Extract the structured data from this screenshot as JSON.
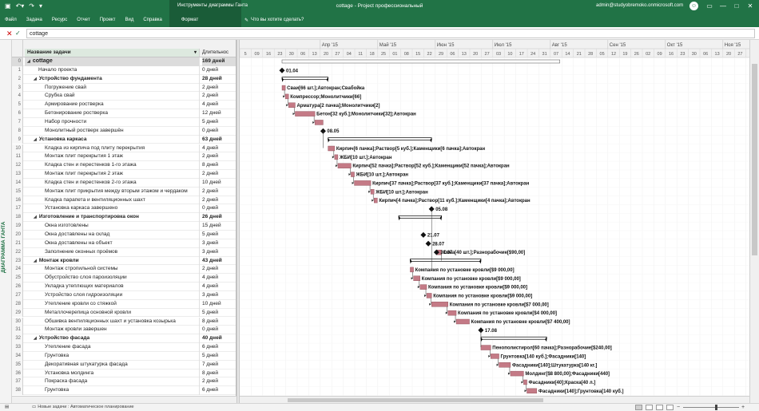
{
  "window": {
    "title": "cottage  -  Project профессиональный",
    "account": "admin@studyobremoko.onmicrosoft.com",
    "avatar": "☺",
    "context_tab_group": "Инструменты диаграммы Ганта",
    "context_tab": "Формат",
    "tell_me": "Что вы хотите сделать?",
    "help_icon": "question-icon"
  },
  "ribbon": {
    "tabs": [
      "Файл",
      "Задача",
      "Ресурс",
      "Отчет",
      "Проект",
      "Вид",
      "Справка"
    ]
  },
  "entry_bar": {
    "value": "cottage"
  },
  "side_view_label": "ДИАГРАММА ГАНТА",
  "grid": {
    "col_name": "Название задачи",
    "col_duration": "Длительнос",
    "rows": [
      {
        "id": "0",
        "name": "cottage",
        "dur": "169 дней",
        "level": 0,
        "summary": true
      },
      {
        "id": "1",
        "name": "Начало проекта",
        "dur": "0 дней",
        "level": 1,
        "summary": false
      },
      {
        "id": "2",
        "name": "Устройство фундамента",
        "dur": "28 дней",
        "level": 1,
        "summary": true
      },
      {
        "id": "3",
        "name": "Погружение свай",
        "dur": "2 дней",
        "level": 2,
        "summary": false
      },
      {
        "id": "4",
        "name": "Срубка свай",
        "dur": "2 дней",
        "level": 2,
        "summary": false
      },
      {
        "id": "5",
        "name": "Армирование ростверка",
        "dur": "4 дней",
        "level": 2,
        "summary": false
      },
      {
        "id": "6",
        "name": "Бетонирование ростверка",
        "dur": "12 дней",
        "level": 2,
        "summary": false
      },
      {
        "id": "7",
        "name": "Набор прочности",
        "dur": "5 дней",
        "level": 2,
        "summary": false
      },
      {
        "id": "8",
        "name": "Монолитный ростверк завершён",
        "dur": "0 дней",
        "level": 2,
        "summary": false
      },
      {
        "id": "9",
        "name": "Установка каркаса",
        "dur": "63 дней",
        "level": 1,
        "summary": true
      },
      {
        "id": "10",
        "name": "Кладка из кирпича под плиту перекрытия",
        "dur": "4 дней",
        "level": 2,
        "summary": false
      },
      {
        "id": "11",
        "name": "Монтаж плит перекрытия 1 этаж",
        "dur": "2 дней",
        "level": 2,
        "summary": false
      },
      {
        "id": "12",
        "name": "Кладка стен и перестенков 1-го этажа",
        "dur": "8 дней",
        "level": 2,
        "summary": false
      },
      {
        "id": "13",
        "name": "Монтаж плит перекрытия 2 этаж",
        "dur": "2 дней",
        "level": 2,
        "summary": false
      },
      {
        "id": "14",
        "name": "Кладка стен и перестенков 2-го этажа",
        "dur": "10 дней",
        "level": 2,
        "summary": false
      },
      {
        "id": "15",
        "name": "Монтаж плит прикрытия между вторым этажом и чердаком",
        "dur": "2 дней",
        "level": 2,
        "summary": false
      },
      {
        "id": "16",
        "name": "Кладка парапета и вентиляционных шахт",
        "dur": "2 дней",
        "level": 2,
        "summary": false
      },
      {
        "id": "17",
        "name": "Установка каркаса завершено",
        "dur": "0 дней",
        "level": 2,
        "summary": false
      },
      {
        "id": "18",
        "name": "Изготовление и транспортировка окон",
        "dur": "26 дней",
        "level": 1,
        "summary": true
      },
      {
        "id": "19",
        "name": "Окна изготовлены",
        "dur": "15 дней",
        "level": 2,
        "summary": false
      },
      {
        "id": "20",
        "name": "Окна доставлены на склад",
        "dur": "5 дней",
        "level": 2,
        "summary": false
      },
      {
        "id": "21",
        "name": "Окна доставлены на объект",
        "dur": "3 дней",
        "level": 2,
        "summary": false
      },
      {
        "id": "22",
        "name": "Заполнение оконных проёмов",
        "dur": "3 дней",
        "level": 2,
        "summary": false
      },
      {
        "id": "23",
        "name": "Монтаж кровли",
        "dur": "43 дней",
        "level": 1,
        "summary": true
      },
      {
        "id": "24",
        "name": "Монтаж стропильной системы",
        "dur": "2 дней",
        "level": 2,
        "summary": false
      },
      {
        "id": "25",
        "name": "Обустройство слоя пароизоляции",
        "dur": "4 дней",
        "level": 2,
        "summary": false
      },
      {
        "id": "26",
        "name": "Укладка утеплющих материалов",
        "dur": "4 дней",
        "level": 2,
        "summary": false
      },
      {
        "id": "27",
        "name": "Устройство слоя гидроизоляции",
        "dur": "3 дней",
        "level": 2,
        "summary": false
      },
      {
        "id": "28",
        "name": "Утепление кровли со стяжкой",
        "dur": "10 дней",
        "level": 2,
        "summary": false
      },
      {
        "id": "29",
        "name": "Металлочерепица основной кровли",
        "dur": "5 дней",
        "level": 2,
        "summary": false
      },
      {
        "id": "30",
        "name": "Обшивка вентиляционных шахт и установка козырька",
        "dur": "8 дней",
        "level": 2,
        "summary": false
      },
      {
        "id": "31",
        "name": "Монтаж кровли завершен",
        "dur": "0 дней",
        "level": 2,
        "summary": false
      },
      {
        "id": "32",
        "name": "Устройство фасада",
        "dur": "40 дней",
        "level": 1,
        "summary": true
      },
      {
        "id": "33",
        "name": "Утепление фасада",
        "dur": "6 дней",
        "level": 2,
        "summary": false
      },
      {
        "id": "34",
        "name": "Грунтовка",
        "dur": "5 дней",
        "level": 2,
        "summary": false
      },
      {
        "id": "35",
        "name": "Декоративная штукатурка фасада",
        "dur": "7 дней",
        "level": 2,
        "summary": false
      },
      {
        "id": "36",
        "name": "Установка молдинга",
        "dur": "8 дней",
        "level": 2,
        "summary": false
      },
      {
        "id": "37",
        "name": "Покраска фасада",
        "dur": "2 дней",
        "level": 2,
        "summary": false
      },
      {
        "id": "38",
        "name": "Грунтовка",
        "dur": "6 дней",
        "level": 2,
        "summary": false
      }
    ]
  },
  "timescale": {
    "months": [
      {
        "label": "Апр '15",
        "col": 7
      },
      {
        "label": "Май '15",
        "col": 12
      },
      {
        "label": "Июн '15",
        "col": 17
      },
      {
        "label": "Июл '15",
        "col": 22
      },
      {
        "label": "Авг '15",
        "col": 27
      },
      {
        "label": "Сен '15",
        "col": 32
      },
      {
        "label": "Окт '15",
        "col": 37
      },
      {
        "label": "Ноя '15",
        "col": 42
      },
      {
        "label": "Дек '15",
        "col": 47
      }
    ],
    "weeks": [
      "5",
      "09",
      "16",
      "23",
      "30",
      "06",
      "13",
      "20",
      "27",
      "04",
      "11",
      "18",
      "25",
      "01",
      "08",
      "15",
      "22",
      "29",
      "06",
      "13",
      "20",
      "27",
      "03",
      "10",
      "17",
      "24",
      "31",
      "07",
      "14",
      "21",
      "28",
      "05",
      "12",
      "19",
      "26",
      "02",
      "09",
      "16",
      "23",
      "30",
      "06",
      "13",
      "20",
      "27",
      "04",
      "11",
      "18",
      "25"
    ]
  },
  "gantt": {
    "summaries": [
      {
        "row": 0,
        "start": 0,
        "end": 169
      },
      {
        "row": 2,
        "start": 0,
        "end": 28
      },
      {
        "row": 9,
        "start": 28,
        "end": 91
      },
      {
        "row": 18,
        "start": 71,
        "end": 97
      },
      {
        "row": 23,
        "start": 78,
        "end": 121
      },
      {
        "row": 32,
        "start": 121,
        "end": 161
      }
    ],
    "tasks": [
      {
        "row": 3,
        "start": 0,
        "end": 2,
        "label": "Сваи[66 шт.];Автокран;Свабойка"
      },
      {
        "row": 4,
        "start": 2,
        "end": 4,
        "label": "Компрессор;Монолитчики[66]"
      },
      {
        "row": 5,
        "start": 4,
        "end": 8,
        "label": "Арматура[2 пачка];Монолитчики[2]"
      },
      {
        "row": 6,
        "start": 8,
        "end": 20,
        "label": "Бетон[32 куб.];Монолитчики[32];Автокран"
      },
      {
        "row": 7,
        "start": 20,
        "end": 25,
        "label": ""
      },
      {
        "row": 10,
        "start": 28,
        "end": 32,
        "label": "Кирпич[6 пачка];Раствор[5 куб.];Каменщики[6 пачка];Автокран"
      },
      {
        "row": 11,
        "start": 32,
        "end": 34,
        "label": "ЖБИ[10 шт.];Автокран"
      },
      {
        "row": 12,
        "start": 34,
        "end": 42,
        "label": "Кирпич[52 пачка];Раствор[52 куб.];Каменщики[52 пачка];Автокран"
      },
      {
        "row": 13,
        "start": 42,
        "end": 44,
        "label": "ЖБИ[10 шт.];Автокран"
      },
      {
        "row": 14,
        "start": 44,
        "end": 54,
        "label": "Кирпич[37 пачка];Раствор[37 куб.];Каменщики[37 пачка];Автокран"
      },
      {
        "row": 15,
        "start": 54,
        "end": 56,
        "label": "ЖБИ[10 шт.];Автокран"
      },
      {
        "row": 16,
        "start": 56,
        "end": 58,
        "label": "Кирпич[4 пачка];Раствор[11 куб.];Каменщики[4 пачка];Автокран"
      },
      {
        "row": 22,
        "start": 94,
        "end": 97,
        "label": "Окна[40 шт.];Разнорабочие[$90,00]"
      },
      {
        "row": 24,
        "start": 78,
        "end": 80,
        "label": "Компания по установке кровли[$9 000,00]"
      },
      {
        "row": 25,
        "start": 80,
        "end": 84,
        "label": "Компания по установке кровли[$9 000,00]"
      },
      {
        "row": 26,
        "start": 84,
        "end": 88,
        "label": "Компания по установке кровли[$9 000,00]"
      },
      {
        "row": 27,
        "start": 88,
        "end": 91,
        "label": "Компания по установке кровли[$9 000,00]"
      },
      {
        "row": 28,
        "start": 91,
        "end": 101,
        "label": "Компания по установке кровли[$7 000,00]"
      },
      {
        "row": 29,
        "start": 101,
        "end": 106,
        "label": "Компания по установке кровли[$4 000,00]"
      },
      {
        "row": 30,
        "start": 106,
        "end": 114,
        "label": "Компания по установке кровли[$7 400,00]"
      },
      {
        "row": 33,
        "start": 121,
        "end": 127,
        "label": "Пенополистирол[60 пачка];Разнорабочие[$240,00]"
      },
      {
        "row": 34,
        "start": 127,
        "end": 132,
        "label": "Грунтовка[140 куб.];Фасадники[140]"
      },
      {
        "row": 35,
        "start": 132,
        "end": 139,
        "label": "Фасадники[140];Штукатурка[140 кг.]"
      },
      {
        "row": 36,
        "start": 139,
        "end": 147,
        "label": "Молдинг[$8 800,00];Фасадники[440]"
      },
      {
        "row": 37,
        "start": 147,
        "end": 149,
        "label": "Фасадники[40];Краска[40 л.]"
      },
      {
        "row": 38,
        "start": 149,
        "end": 155,
        "label": "Фасадники[140];Грунтовка[140 куб.]"
      }
    ],
    "milestones": [
      {
        "row": 1,
        "day": 0,
        "label": "01.04"
      },
      {
        "row": 8,
        "day": 25,
        "label": "08.05"
      },
      {
        "row": 17,
        "day": 91,
        "label": "05.08"
      },
      {
        "row": 20,
        "day": 86,
        "label": "21.07"
      },
      {
        "row": 21,
        "day": 89,
        "label": "28.07"
      },
      {
        "row": 22,
        "day": 94,
        "label": "31.07"
      },
      {
        "row": 31,
        "day": 121,
        "label": "17.08"
      }
    ]
  },
  "status": {
    "ready_icon": "ready-icon",
    "new_tasks": "Новые задачи : Автоматическое планирование"
  },
  "colors": {
    "brand": "#217346",
    "bar": "#c47a86",
    "summary": "#000000"
  }
}
